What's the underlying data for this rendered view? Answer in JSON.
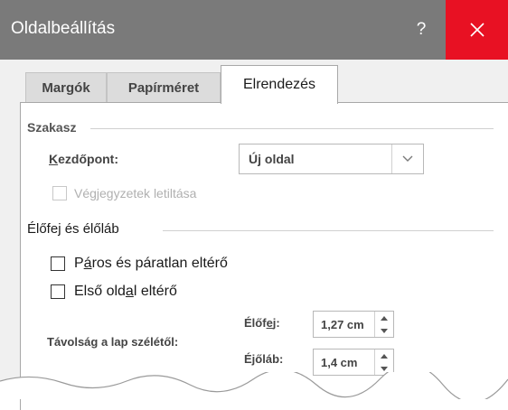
{
  "window": {
    "title": "Oldalbeállítás",
    "help_label": "?",
    "close_icon": "close-icon",
    "close_color": "#e81123"
  },
  "tabs": [
    {
      "label": "Margók",
      "selected": false
    },
    {
      "label": "Papírméret",
      "selected": false
    },
    {
      "label": "Elrendezés",
      "selected": true
    }
  ],
  "section": {
    "group_label": "Szakasz",
    "start_label": "Kezdőpont:",
    "start_value": "Új oldal",
    "suppress_endnotes_label": "Végjegyzetek letiltása",
    "suppress_endnotes_checked": false
  },
  "headers_footers": {
    "group_label": "Élőfej és élőláb",
    "odd_even_label": "Páros és páratlan eltérő",
    "odd_even_checked": false,
    "first_page_label": "Első oldal eltérő",
    "first_page_checked": false,
    "distance_label": "Távolság a lap szélétől:",
    "header_label": "Élőfej:",
    "header_value": "1,27 cm",
    "footer_label": "Éjőláb:",
    "footer_value": "1,4 cm"
  }
}
